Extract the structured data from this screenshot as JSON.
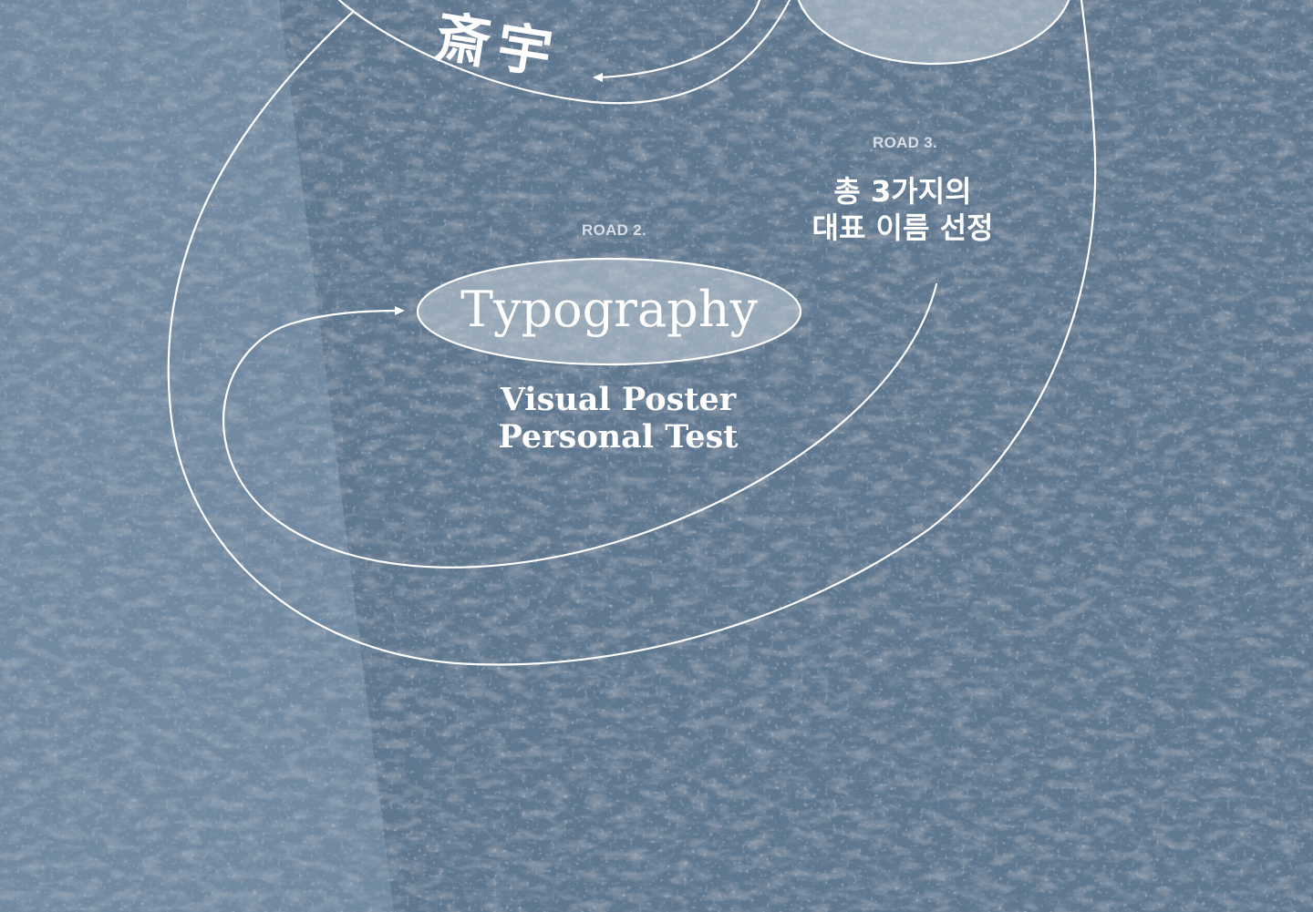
{
  "road2": {
    "label": "ROAD 2.",
    "title": "Typography",
    "subtitle_line1": "Visual Poster",
    "subtitle_line2": "Personal Test"
  },
  "road3": {
    "label": "ROAD 3.",
    "desc_line1": "총 3가지의",
    "desc_line2": "대표 이름 선정"
  },
  "top_title": "斎宇",
  "colors": {
    "background": "#5f7890",
    "light_panel": "#8aa2b8",
    "line": "#ffffff"
  }
}
